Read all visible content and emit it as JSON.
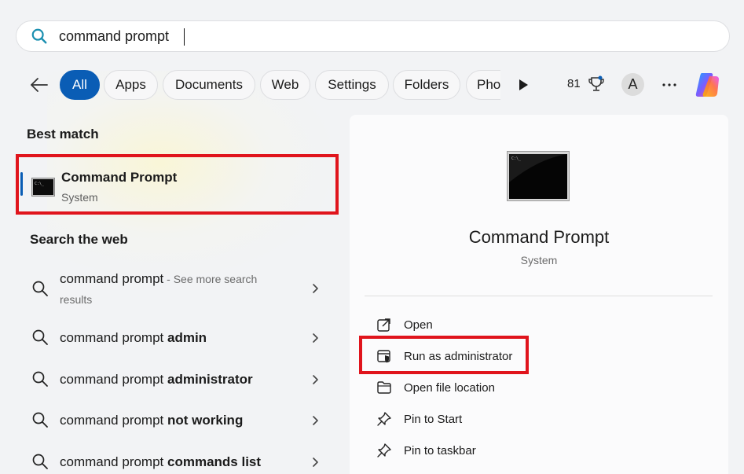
{
  "search": {
    "value": "command prompt",
    "placeholder": ""
  },
  "filters": {
    "chips": [
      "All",
      "Apps",
      "Documents",
      "Web",
      "Settings",
      "Folders",
      "Pho"
    ],
    "active": "All",
    "points": "81",
    "avatar_letter": "A"
  },
  "best_match": {
    "heading": "Best match",
    "title": "Command Prompt",
    "subtitle": "System"
  },
  "web": {
    "heading": "Search the web",
    "items": [
      {
        "normal": "command prompt",
        "bold": "",
        "muted": " - See more search",
        "muted2": "results"
      },
      {
        "normal": "command prompt ",
        "bold": "admin"
      },
      {
        "normal": "command prompt ",
        "bold": "administrator"
      },
      {
        "normal": "command prompt ",
        "bold": "not working"
      },
      {
        "normal": "command prompt ",
        "bold": "commands list"
      }
    ]
  },
  "details": {
    "title": "Command Prompt",
    "subtitle": "System",
    "actions": [
      {
        "label": "Open",
        "icon": "open-external-icon"
      },
      {
        "label": "Run as administrator",
        "icon": "shield-admin-icon"
      },
      {
        "label": "Open file location",
        "icon": "folder-icon"
      },
      {
        "label": "Pin to Start",
        "icon": "pin-icon"
      },
      {
        "label": "Pin to taskbar",
        "icon": "pin-icon"
      }
    ]
  },
  "colors": {
    "accent": "#0a5db5",
    "highlight_box": "#e0141c",
    "background": "#f2f3f5"
  }
}
